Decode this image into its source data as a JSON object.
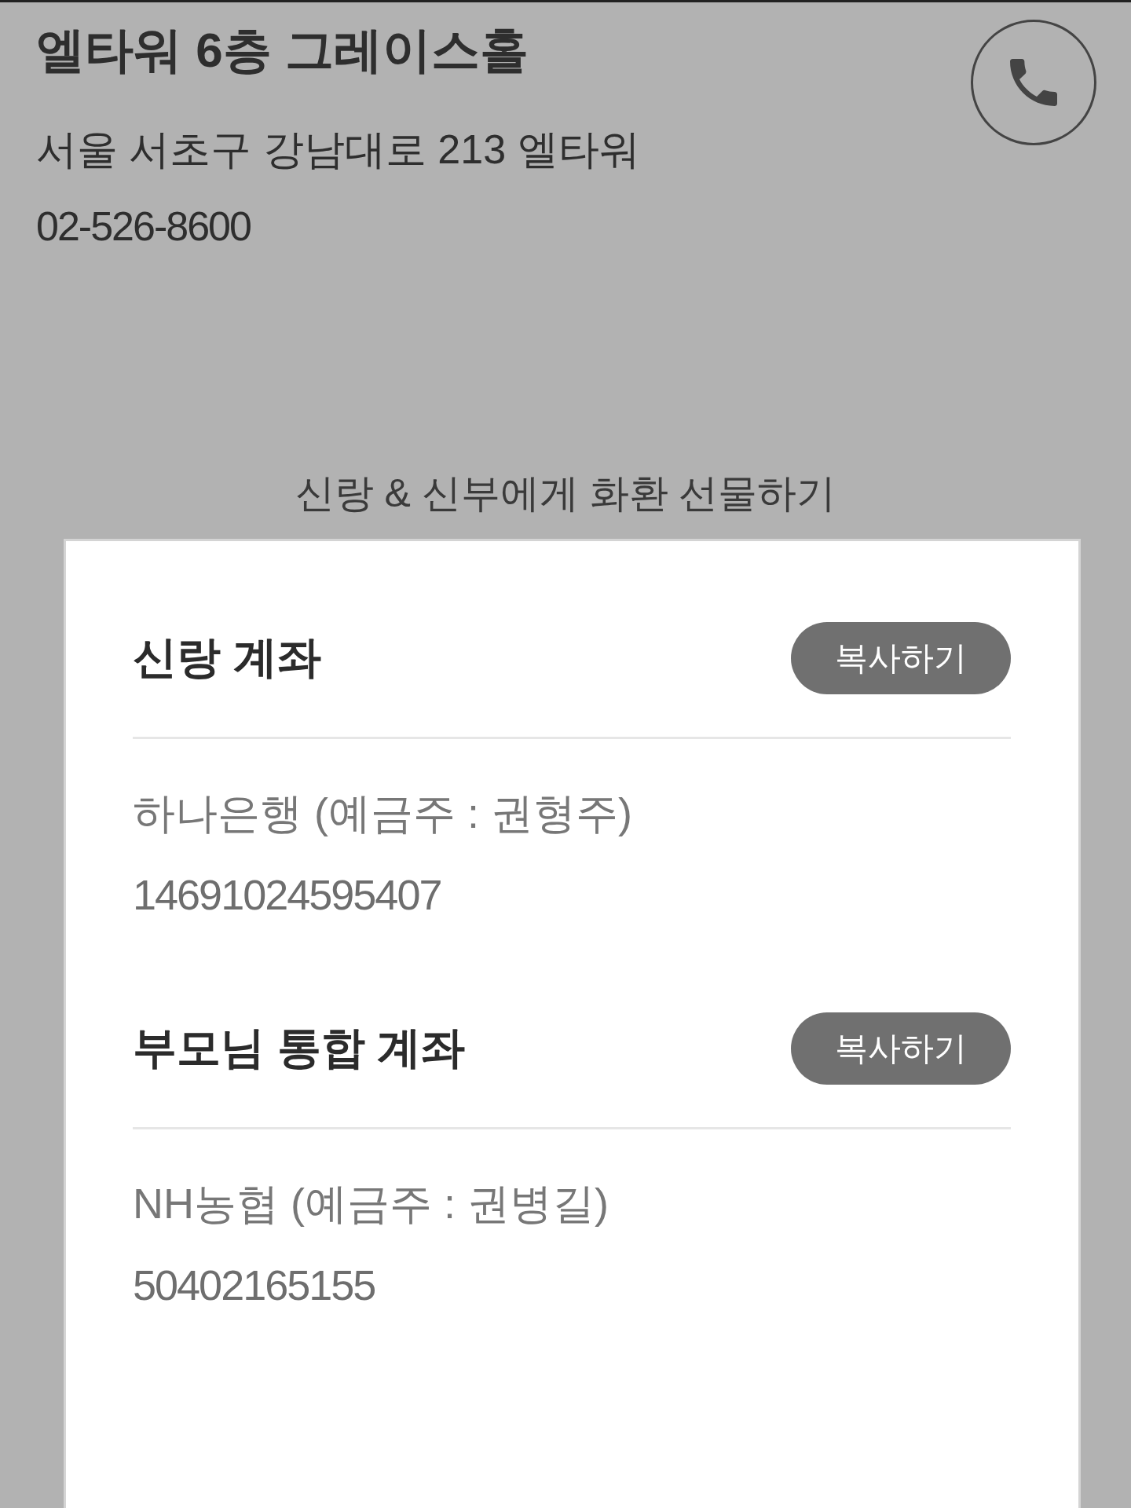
{
  "venue": {
    "name": "엘타워 6층 그레이스홀",
    "address": "서울 서초구 강남대로 213 엘타워",
    "phone": "02-526-8600"
  },
  "gift_link": "신랑 & 신부에게 화환 선물하기",
  "accounts": [
    {
      "title": "신랑 계좌",
      "button": "복사하기",
      "bank": "하나은행 (예금주 : 권형주)",
      "number": "14691024595407"
    },
    {
      "title": "부모님 통합 계좌",
      "button": "복사하기",
      "bank": "NH농협 (예금주 : 권병길)",
      "number": "50402165155"
    }
  ]
}
